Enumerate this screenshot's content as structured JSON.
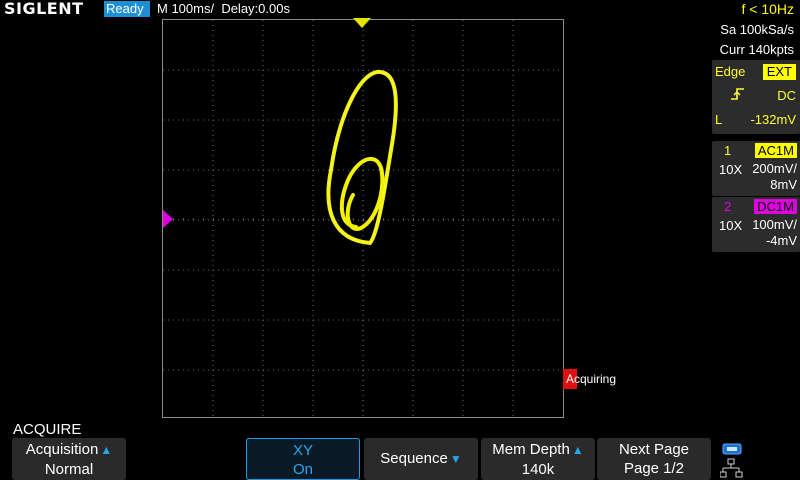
{
  "header": {
    "brand": "SIGLENT",
    "run_state": "Ready",
    "timebase": "M 100ms/",
    "delay": "Delay:0.00s",
    "freq": "f < 10Hz"
  },
  "acquisition_info": {
    "sample_rate": "Sa 100kSa/s",
    "memory": "Curr 140kpts"
  },
  "trigger": {
    "type": "Edge",
    "source": "EXT",
    "coupling": "DC",
    "level_label": "L",
    "level": "-132mV"
  },
  "channels": [
    {
      "number": "1",
      "coupling": "AC1M",
      "probe": "10X",
      "scale": "200mV/",
      "offset": "8mV",
      "color": "#ffff00"
    },
    {
      "number": "2",
      "coupling": "DC1M",
      "probe": "10X",
      "scale": "100mV/",
      "offset": "-4mV",
      "color": "#e000e0"
    }
  ],
  "status_flag": "Acquiring",
  "menu": {
    "title": "ACQUIRE",
    "softkeys": [
      {
        "line1": "Acquisition",
        "line2": "Normal"
      },
      {
        "line1": "XY",
        "line2": "On"
      },
      {
        "line1": "Sequence"
      },
      {
        "line1": "Mem Depth",
        "line2": "140k"
      },
      {
        "line1": "Next Page",
        "line2": "Page 1/2"
      }
    ]
  },
  "colors": {
    "trace": "#ffff00",
    "ch2": "#e000e0",
    "accent": "#1f8fd4",
    "flag": "#e01010"
  },
  "icons": [
    "trigger-marker-icon",
    "ch2-ground-marker-icon",
    "rising-edge-icon",
    "sort-arrow-icon",
    "usb-icon",
    "network-icon"
  ]
}
